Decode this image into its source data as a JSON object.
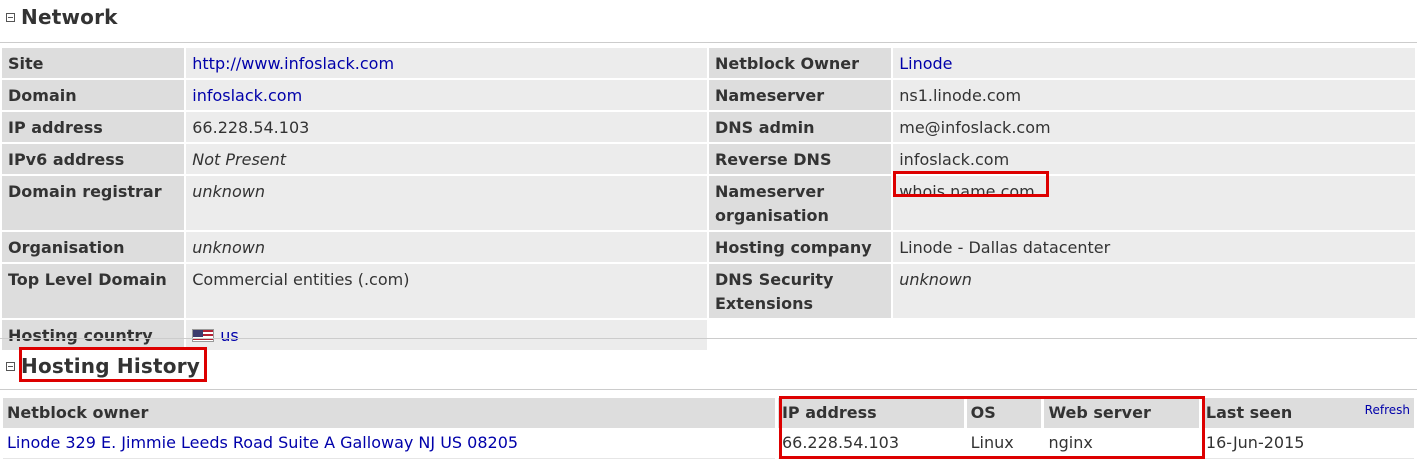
{
  "network": {
    "title": "Network",
    "rows": [
      {
        "l1": "Site",
        "v1": "http://www.infoslack.com",
        "l2": "Netblock Owner",
        "v2": "Linode"
      },
      {
        "l1": "Domain",
        "v1": "infoslack.com",
        "l2": "Nameserver",
        "v2": "ns1.linode.com"
      },
      {
        "l1": "IP address",
        "v1": "66.228.54.103",
        "l2": "DNS admin",
        "v2": "me@infoslack.com"
      },
      {
        "l1": "IPv6 address",
        "v1": "Not Present",
        "l2": "Reverse DNS",
        "v2": "infoslack.com"
      },
      {
        "l1": "Domain registrar",
        "v1": "unknown",
        "l2": "Nameserver organisation",
        "v2": "whois.name.com"
      },
      {
        "l1": "Organisation",
        "v1": "unknown",
        "l2": "Hosting company",
        "v2": "Linode - Dallas datacenter"
      },
      {
        "l1": "Top Level Domain",
        "v1": "Commercial entities (.com)",
        "l2": "DNS Security Extensions",
        "v2": "unknown"
      },
      {
        "l1": "Hosting country",
        "v1": "us"
      }
    ]
  },
  "history": {
    "title": "Hosting History",
    "headers": {
      "netblock_owner": "Netblock owner",
      "ip_address": "IP address",
      "os": "OS",
      "web_server": "Web server",
      "last_seen": "Last seen",
      "refresh": "Refresh"
    },
    "rows": [
      {
        "netblock_owner": "Linode 329 E. Jimmie Leeds Road Suite A Galloway NJ US 08205",
        "ip_address": "66.228.54.103",
        "os": "Linux",
        "web_server": "nginx",
        "last_seen": "16-Jun-2015"
      }
    ]
  },
  "colors": {
    "highlight": "#dd0000",
    "link": "#0000aa",
    "label_bg": "#dddddd",
    "value_bg": "#ececec"
  }
}
